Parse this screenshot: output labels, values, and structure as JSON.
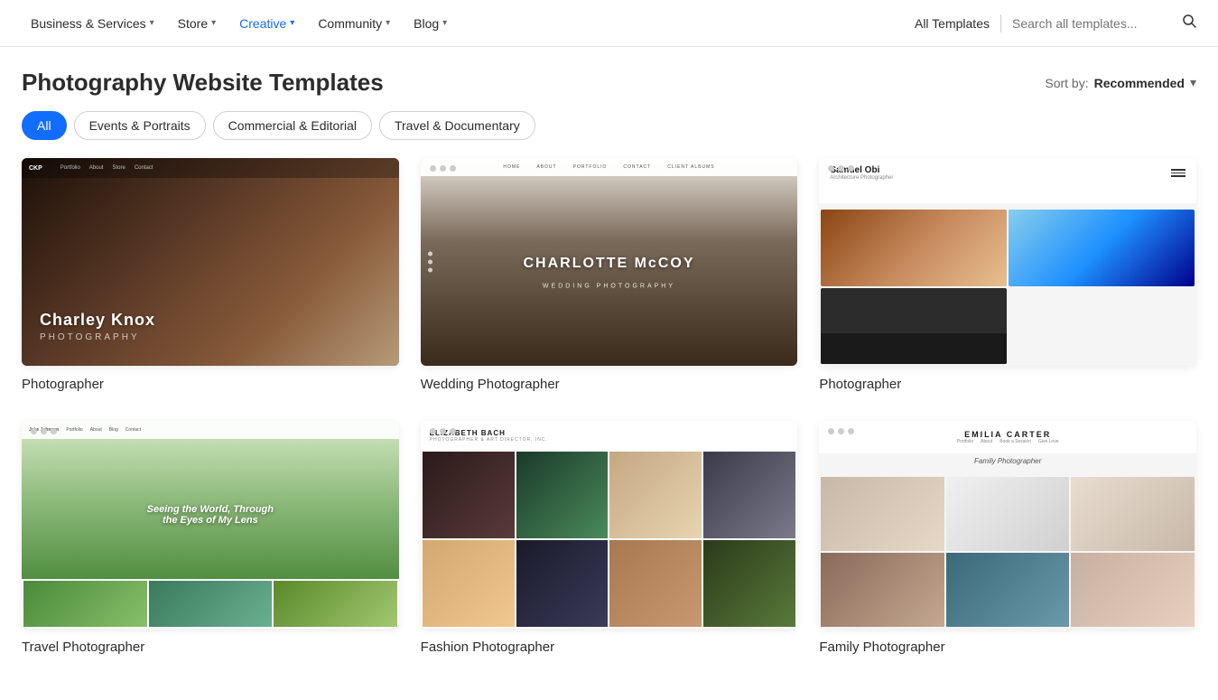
{
  "nav": {
    "items": [
      {
        "id": "business-services",
        "label": "Business & Services",
        "hasDropdown": true,
        "active": false
      },
      {
        "id": "store",
        "label": "Store",
        "hasDropdown": true,
        "active": false
      },
      {
        "id": "creative",
        "label": "Creative",
        "hasDropdown": true,
        "active": true
      },
      {
        "id": "community",
        "label": "Community",
        "hasDropdown": true,
        "active": false
      },
      {
        "id": "blog",
        "label": "Blog",
        "hasDropdown": true,
        "active": false
      }
    ],
    "allTemplates": "All Templates",
    "searchPlaceholder": "Search all templates...",
    "sortLabel": "Sort by:",
    "sortValue": "Recommended"
  },
  "page": {
    "title": "Photography Website Templates",
    "filters": [
      {
        "id": "all",
        "label": "All",
        "active": true
      },
      {
        "id": "events-portraits",
        "label": "Events & Portraits",
        "active": false
      },
      {
        "id": "commercial-editorial",
        "label": "Commercial & Editorial",
        "active": false
      },
      {
        "id": "travel-documentary",
        "label": "Travel & Documentary",
        "active": false
      }
    ]
  },
  "templates": [
    {
      "id": "charley-knox",
      "label": "Photographer",
      "themeName": "Charley Knox Photography",
      "themeSubtitle": "PHOTOGRAPHY"
    },
    {
      "id": "charlotte-mccoy",
      "label": "Wedding Photographer",
      "themeName": "CHARLOTTE McCOY",
      "themeSubtitle": "WEDDING PHOTOGRAPHY"
    },
    {
      "id": "samuel-obi",
      "label": "Photographer",
      "themeName": "Samuel Obi",
      "themeSubtitle": "Architecture Photographer"
    },
    {
      "id": "travel-photographer",
      "label": "Travel Photographer",
      "themeMain": "Seeing the World, Through the Eyes of My Lens"
    },
    {
      "id": "elizabeth-bach",
      "label": "Fashion Photographer",
      "themeName": "ELIZABETH BACH",
      "themeSubtitle": "PHOTOGRAPHER & ART DIRECTOR, INC."
    },
    {
      "id": "emilia-carter",
      "label": "Family Photographer",
      "themeName": "EMILIA CARTER",
      "themeSubtitle": "Family Photographer"
    }
  ]
}
